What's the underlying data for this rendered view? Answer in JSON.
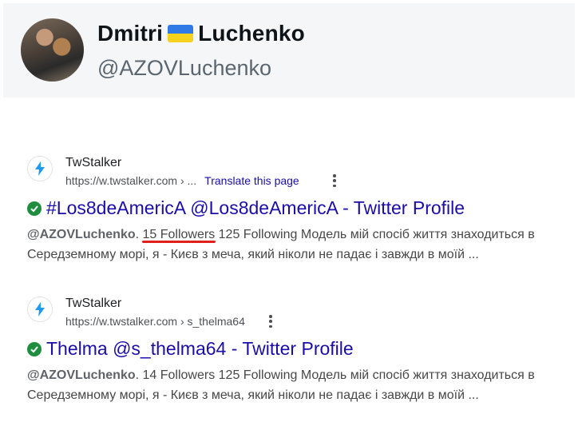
{
  "profile": {
    "name_first": "Dmitri",
    "name_last": "Luchenko",
    "flag": "ukraine-flag",
    "handle": "@AZOVLuchenko"
  },
  "results": [
    {
      "site_name": "TwStalker",
      "url": "https://w.twstalker.com › ...",
      "translate": "Translate this page",
      "title": "#Los8deAmericA @Los8deAmericA - Twitter Profile",
      "verified": true,
      "snippet_handle": "@AZOVLuchenko",
      "snippet_followers": "15 Followers",
      "snippet_line1_rest": " 125 Following Модель мій спосіб життя знаходиться в",
      "snippet_line2": "Середземному морі, я - Києв з меча, який ніколи не падає і завжди в моїй ..."
    },
    {
      "site_name": "TwStalker",
      "url": "https://w.twstalker.com › s_thelma64",
      "title": "Thelma @s_thelma64 - Twitter Profile",
      "verified": true,
      "snippet_handle": "@AZOVLuchenko",
      "snippet_followers": "14 Followers",
      "snippet_line1_rest": " 125 Following Модель мій спосіб життя знаходиться в",
      "snippet_line2": "Середземному морі, я - Києв з меча, який ніколи не падає і завжди в моїй ..."
    }
  ],
  "colors": {
    "link": "#1a0dab",
    "verified": "#1e8e3e",
    "annotation": "#e0201a",
    "card_bg": "#f5f6f7"
  }
}
